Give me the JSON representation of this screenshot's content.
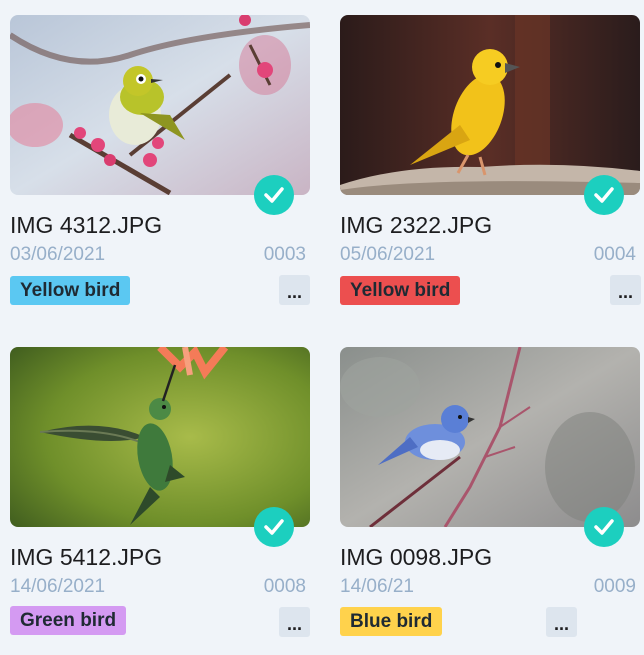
{
  "cards": [
    {
      "filename": "IMG 4312.JPG",
      "date": "03/06/2021",
      "number": "0003",
      "tag": "Yellow bird",
      "tag_color": "#5bc8f2",
      "more": "...",
      "selected": true,
      "image_icon": "white-eye-bird-photo"
    },
    {
      "filename": "IMG 2322.JPG",
      "date": "05/06/2021",
      "number": "0004",
      "tag": "Yellow bird",
      "tag_color": "#ec4f4f",
      "more": "...",
      "selected": true,
      "image_icon": "yellow-canary-photo"
    },
    {
      "filename": "IMG 5412.JPG",
      "date": "14/06/2021",
      "number": "0008",
      "tag": "Green bird",
      "tag_color": "#d49af2",
      "more": "...",
      "selected": true,
      "image_icon": "hummingbird-photo"
    },
    {
      "filename": "IMG 0098.JPG",
      "date": "14/06/21",
      "number": "0009",
      "tag": "Blue bird",
      "tag_color": "#ffd24c",
      "more": "...",
      "selected": true,
      "image_icon": "bluebird-photo"
    }
  ],
  "check_color": "#1ccfbf"
}
